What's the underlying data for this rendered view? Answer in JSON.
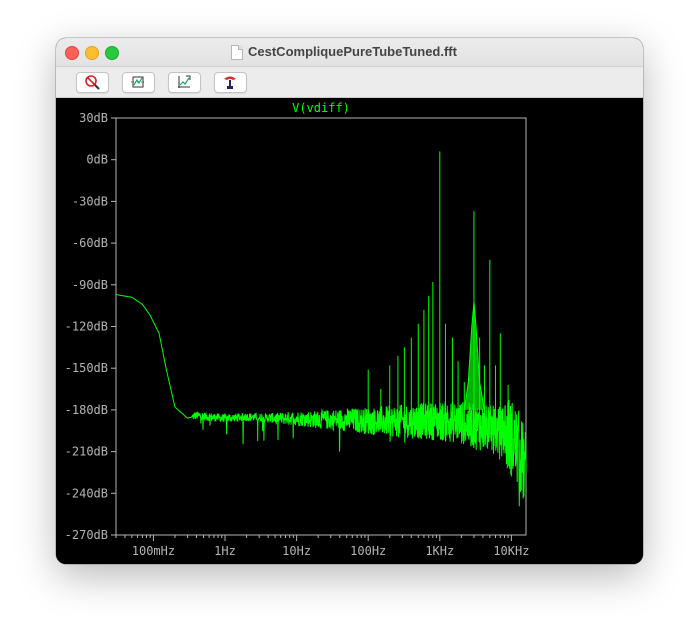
{
  "window": {
    "title": "CestCompliquePureTubeTuned.fft"
  },
  "toolbar": {
    "buttons": [
      {
        "name": "zoom-cancel",
        "icon": "zoom-cancel-icon"
      },
      {
        "name": "autorange",
        "icon": "autorange-icon"
      },
      {
        "name": "pan",
        "icon": "pan-icon"
      },
      {
        "name": "probe",
        "icon": "probe-icon"
      }
    ]
  },
  "colors": {
    "trace": "#00ff00",
    "axis": "#b4b4b4",
    "background": "#000000"
  },
  "chart_data": {
    "type": "line",
    "title": "V(vdiff)",
    "xlabel": "",
    "ylabel": "",
    "x_scale": "log",
    "xlim": [
      0.03,
      16000
    ],
    "ylim": [
      -270,
      30
    ],
    "grid": false,
    "y_ticks": [
      "30dB",
      "0dB",
      "-30dB",
      "-60dB",
      "-90dB",
      "-120dB",
      "-150dB",
      "-180dB",
      "-210dB",
      "-240dB",
      "-270dB"
    ],
    "y_tick_values": [
      30,
      0,
      -30,
      -60,
      -90,
      -120,
      -150,
      -180,
      -210,
      -240,
      -270
    ],
    "x_ticks": [
      "100mHz",
      "1Hz",
      "10Hz",
      "100Hz",
      "1KHz",
      "10KHz"
    ],
    "x_tick_values": [
      0.1,
      1,
      10,
      100,
      1000,
      10000
    ],
    "series": [
      {
        "name": "V(vdiff)",
        "x": [
          0.03,
          0.05,
          0.07,
          0.09,
          0.12,
          0.15,
          0.2,
          0.3,
          0.4,
          0.6,
          1,
          2,
          5,
          10,
          20,
          50,
          100,
          200,
          500,
          1000,
          2000,
          3000,
          5000,
          8000,
          10000,
          13000,
          16000
        ],
        "y": [
          -97,
          -99,
          -104,
          -112,
          -125,
          -150,
          -178,
          -186,
          -184,
          -185,
          -186,
          -185,
          -186,
          -186,
          -187,
          -187,
          -188,
          -188,
          -188,
          -188,
          -189,
          -192,
          -194,
          -196,
          -200,
          -210,
          -225
        ],
        "peaks": [
          {
            "x": 100,
            "y": -151
          },
          {
            "x": 150,
            "y": -165
          },
          {
            "x": 200,
            "y": -148
          },
          {
            "x": 260,
            "y": -141
          },
          {
            "x": 320,
            "y": -135
          },
          {
            "x": 400,
            "y": -128
          },
          {
            "x": 500,
            "y": -118
          },
          {
            "x": 600,
            "y": -108
          },
          {
            "x": 700,
            "y": -98
          },
          {
            "x": 800,
            "y": -88
          },
          {
            "x": 1000,
            "y": 6
          },
          {
            "x": 1200,
            "y": -118
          },
          {
            "x": 1500,
            "y": -128
          },
          {
            "x": 1800,
            "y": -145
          },
          {
            "x": 2200,
            "y": -160
          },
          {
            "x": 3000,
            "y": -37
          },
          {
            "x": 3600,
            "y": -128
          },
          {
            "x": 4200,
            "y": -148
          },
          {
            "x": 5000,
            "y": -72
          },
          {
            "x": 6000,
            "y": -148
          },
          {
            "x": 7000,
            "y": -125
          },
          {
            "x": 9000,
            "y": -162
          }
        ]
      }
    ]
  }
}
